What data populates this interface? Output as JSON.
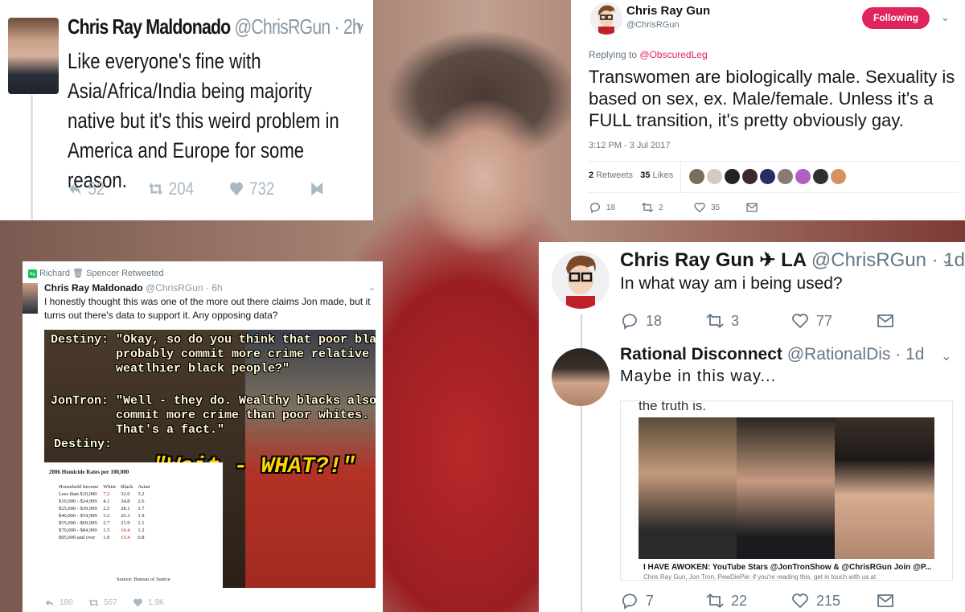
{
  "tweet_a": {
    "name": "Chris Ray Maldonado",
    "handle": "@ChrisRGun · 2h",
    "text": "Like everyone's fine with Asia/Africa/India being majority native but it's this weird problem in America and Europe for some reason.",
    "replies": "52",
    "retweets": "204",
    "likes": "732"
  },
  "tweet_b": {
    "name": "Chris Ray Gun",
    "handle": "@ChrisRGun",
    "follow_label": "Following",
    "replying_prefix": "Replying to",
    "replying_to": "@ObscuredLeg",
    "text": "Transwomen are biologically male. Sexuality is based on sex, ex. Male/female. Unless it's a FULL transition, it's pretty obviously gay.",
    "timestamp": "3:12 PM - 3 Jul 2017",
    "retweets_count": "2",
    "retweets_label": "Retweets",
    "likes_count": "35",
    "likes_label": "Likes",
    "replies": "18",
    "retweets": "2",
    "likes": "35"
  },
  "tweet_c": {
    "retweet_by": "Richard",
    "retweet_by2": "Spencer Retweeted",
    "name": "Chris Ray Maldonado",
    "handle": "@ChrisRGun · 6h",
    "text": "I honestly thought this was one of the more out there claims Jon made, but it turns out there's data to support it. Any opposing data?",
    "meme": {
      "line1": "Destiny: \"Okay, so do you think that poor blacks\n         probably commit more crime relative to\n         weatlhier black people?\"",
      "line2": "JonTron: \"Well - they do. Wealthy blacks also\n         commit more crime than poor whites.\n         That's a fact.\"",
      "line3": "Destiny:",
      "wait": "\"Wait - WHAT?!\""
    },
    "table": {
      "title": "2006 Homicide Rates per 100,000",
      "headers": [
        "Household Income",
        "White",
        "Black",
        "Asian"
      ],
      "rows": [
        [
          "Less than $10,000",
          "7.2",
          "32.6",
          "3.2"
        ],
        [
          "$10,000 - $24,999",
          "4.1",
          "34.8",
          "2.6"
        ],
        [
          "$25,000 - $39,999",
          "2.5",
          "28.1",
          "1.7"
        ],
        [
          "$40,000 - $54,999",
          "3.2",
          "26.3",
          "1.9"
        ],
        [
          "$55,000 - $69,999",
          "2.7",
          "21.9",
          "1.1"
        ],
        [
          "$70,000 - $84,999",
          "1.5",
          "16.4",
          "1.2"
        ],
        [
          "$85,000 and over",
          "1.9",
          "15.4",
          "0.8"
        ]
      ],
      "source": "Source: Bureau of Justice"
    },
    "replies": "180",
    "retweets": "567",
    "likes": "1.9K"
  },
  "tweet_d": {
    "name": "Chris Ray Gun ✈ LA",
    "handle": "@ChrisRGun · 1d",
    "text": "In what way am i being used?",
    "replies": "18",
    "retweets": "3",
    "likes": "77"
  },
  "tweet_e": {
    "name": "Rational Disconnect",
    "handle": "@RationalDis · 1d",
    "text": "Maybe in this way...",
    "card_top_text": "the truth is.",
    "card_title": "I HAVE AWOKEN: YouTube Stars @JonTronShow & @ChrisRGun Join @P...",
    "card_subtitle": "Chris Ray Gun, Jon Tron, PewDiePie: if you're reading this, get in touch with us at",
    "replies": "7",
    "retweets": "22",
    "likes": "215"
  },
  "colors": {
    "twitter_gray": "#657786",
    "follow_pink": "#e0245e",
    "text_dark": "#14171a"
  },
  "icons": [
    "reply-icon",
    "retweet-icon",
    "heart-icon",
    "dm-icon",
    "mail-icon",
    "chevron-down-icon"
  ]
}
